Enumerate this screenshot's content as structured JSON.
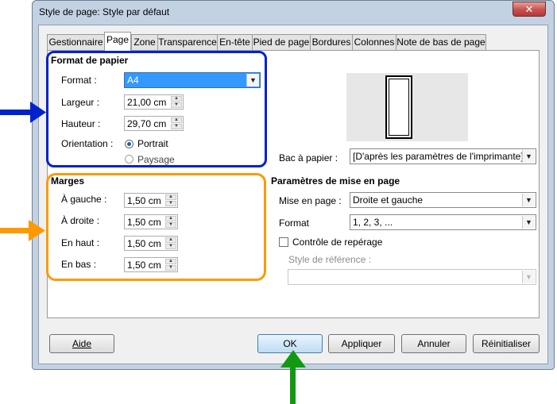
{
  "window": {
    "title": "Style de page: Style par défaut",
    "close_glyph": "✕"
  },
  "tabs": [
    {
      "label": "Gestionnaire"
    },
    {
      "label": "Page",
      "active": true
    },
    {
      "label": "Zone"
    },
    {
      "label": "Transparence"
    },
    {
      "label": "En-tête"
    },
    {
      "label": "Pied de page"
    },
    {
      "label": "Bordures"
    },
    {
      "label": "Colonnes"
    },
    {
      "label": "Note de bas de page"
    }
  ],
  "paper_format": {
    "heading": "Format de papier",
    "format_label": "Format :",
    "format_value": "A4",
    "width_label": "Largeur :",
    "width_value": "21,00 cm",
    "height_label": "Hauteur :",
    "height_value": "29,70 cm",
    "orientation_label": "Orientation :",
    "portrait_label": "Portrait",
    "landscape_label": "Paysage",
    "selected_orientation": "Portrait"
  },
  "paper_tray": {
    "label": "Bac à papier :",
    "value": "[D'après les paramètres de l'imprimante]"
  },
  "margins": {
    "heading": "Marges",
    "left_label": "À gauche :",
    "left_value": "1,50 cm",
    "right_label": "À droite :",
    "right_value": "1,50 cm",
    "top_label": "En haut :",
    "top_value": "1,50 cm",
    "bottom_label": "En bas :",
    "bottom_value": "1,50 cm"
  },
  "layout_settings": {
    "heading": "Paramètres de mise en page",
    "page_layout_label": "Mise en page :",
    "page_layout_value": "Droite et gauche",
    "format_label": "Format",
    "format_value": "1, 2, 3, ...",
    "register_label": "Contrôle de repérage",
    "register_checked": false,
    "reference_style_label": "Style de référence :",
    "reference_style_value": ""
  },
  "buttons": {
    "help": "Aide",
    "ok": "OK",
    "apply": "Appliquer",
    "cancel": "Annuler",
    "reset": "Réinitialiser"
  },
  "annotations": {
    "blue": "#0022cc",
    "orange": "#ff9900",
    "green": "#119911"
  }
}
